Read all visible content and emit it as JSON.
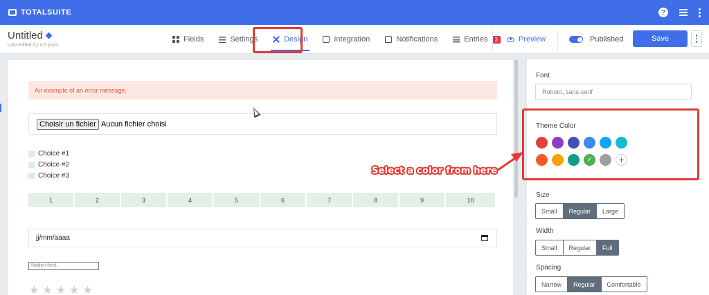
{
  "topbar": {
    "brand": "TOTALSUITE",
    "help_glyph": "?"
  },
  "header": {
    "title": "Untitled",
    "last_edited": "Last edited il y a 5 jours",
    "tabs": [
      {
        "label": "Fields",
        "icon": "grid-icon"
      },
      {
        "label": "Settings",
        "icon": "sliders-icon"
      },
      {
        "label": "Design",
        "icon": "design-icon",
        "active": true
      },
      {
        "label": "Integration",
        "icon": "code-icon"
      },
      {
        "label": "Notifications",
        "icon": "inbox-icon"
      },
      {
        "label": "Entries",
        "icon": "list-icon",
        "badge": "3"
      }
    ],
    "preview_label": "Preview",
    "published_label": "Published",
    "save_label": "Save"
  },
  "canvas": {
    "error_message": "An example of an error message.",
    "file_button": "Choisir un fichier",
    "file_status": "Aucun fichier choisi",
    "choices": [
      "Choice #1",
      "Choice #2",
      "Choice #3"
    ],
    "scale": [
      "1",
      "2",
      "3",
      "4",
      "5",
      "6",
      "7",
      "8",
      "9",
      "10"
    ],
    "date_placeholder": "jj/mm/aaaa",
    "hidden_field": "Hidden field...",
    "star_glyph": "★"
  },
  "panel": {
    "font_label": "Font",
    "font_value": "Roboto, sans-serif",
    "theme_label": "Theme Color",
    "theme_colors_row1": [
      "#e04436",
      "#8e3fc4",
      "#4251b4",
      "#3d8ae8",
      "#0ea5ec",
      "#14bcd0"
    ],
    "theme_colors_row2": [
      "#f35b26",
      "#f9a00a",
      "#0f9d8a",
      "#4caf50",
      "#9e9e9e"
    ],
    "selected_color": "#4caf50",
    "add_color_glyph": "+",
    "size_label": "Size",
    "size_options": [
      "Small",
      "Regular",
      "Large"
    ],
    "size_selected": "Regular",
    "width_label": "Width",
    "width_options": [
      "Small",
      "Regular",
      "Full"
    ],
    "width_selected": "Full",
    "spacing_label": "Spacing",
    "spacing_options": [
      "Narrow",
      "Regular",
      "Comfortable"
    ],
    "spacing_selected": "Regular"
  },
  "annotation": {
    "text": "Select a color from here",
    "color": "#e53935"
  },
  "colors": {
    "primary": "#3f6ee8",
    "annotation": "#e53935"
  }
}
